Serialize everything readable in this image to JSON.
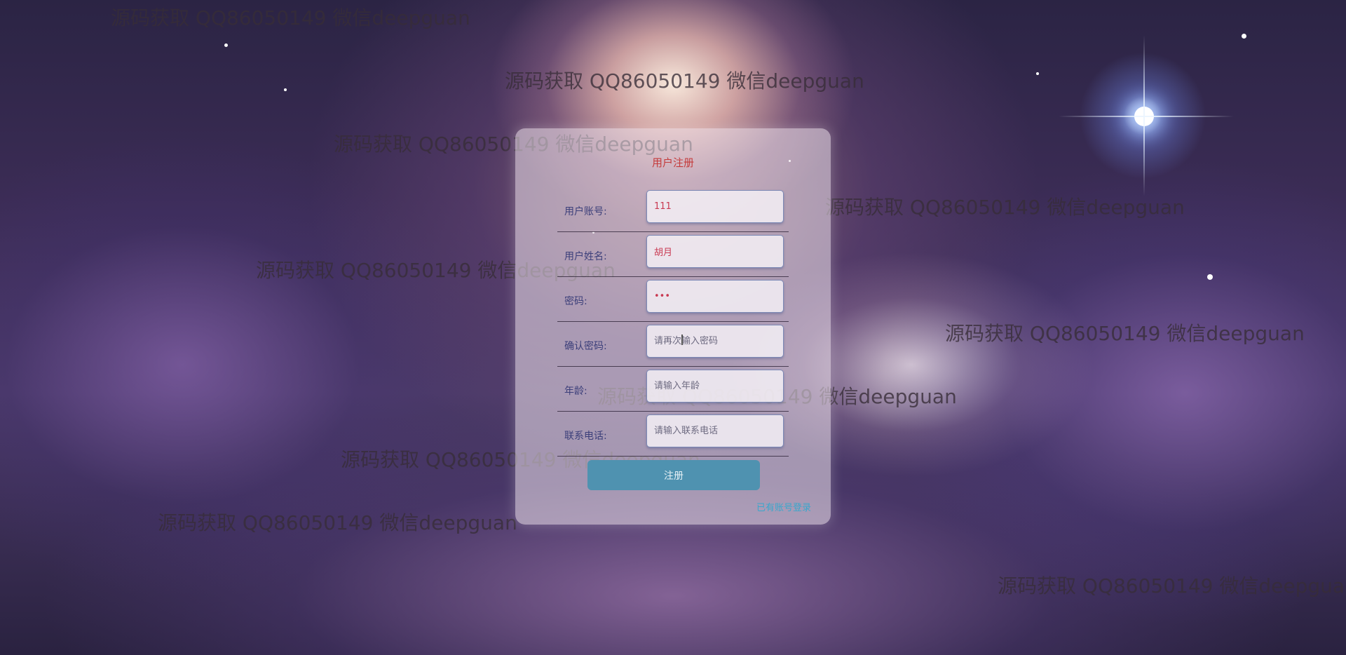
{
  "form": {
    "title": "用户注册",
    "fields": [
      {
        "label": "用户账号:",
        "value": "111",
        "placeholder": "",
        "type": "text"
      },
      {
        "label": "用户姓名:",
        "value": "胡月",
        "placeholder": "",
        "type": "text"
      },
      {
        "label": "密码:",
        "value": "•••",
        "placeholder": "",
        "type": "password"
      },
      {
        "label": "确认密码:",
        "value": "",
        "placeholder": "请再次输入密码",
        "type": "password"
      },
      {
        "label": "年龄:",
        "value": "",
        "placeholder": "请输入年龄",
        "type": "text"
      },
      {
        "label": "联系电话:",
        "value": "",
        "placeholder": "请输入联系电话",
        "type": "text"
      }
    ],
    "submit_label": "注册",
    "login_link": "已有账号登录"
  },
  "watermark": {
    "text": "源码获取 QQ86050149 微信deepguan"
  },
  "colors": {
    "title": "#c43b3b",
    "button": "#4f92b0",
    "link": "#3aa7cc",
    "label": "#3c3f7a",
    "value": "#c93a52"
  }
}
